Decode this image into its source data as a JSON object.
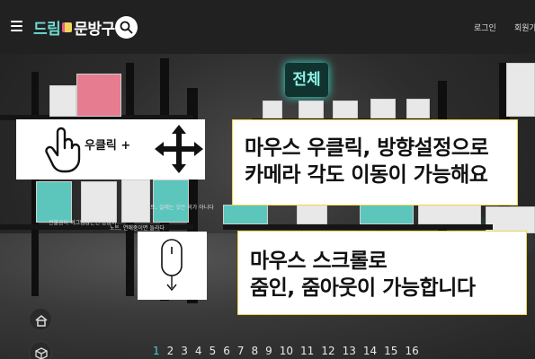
{
  "header": {
    "logo_part1": "드림",
    "logo_part2": "문방구",
    "login_label": "로그인",
    "signup_label": "회원가입"
  },
  "scene": {
    "category_title": "전체",
    "captions": [
      "썬불곰이 여그템갑은런 통꿈이",
      "노트, 실제는 것은 의가 아니다",
      "노트, 연애중이면 들라다"
    ]
  },
  "hints": {
    "right_click_label": "우클릭 +",
    "right_click_text_line1": "마우스 우클릭, 방향설정으로",
    "right_click_text_line2": "카메라 각도 이동이 가능해요",
    "scroll_text_line1": "마우스 스크롤로",
    "scroll_text_line2": "줌인, 줌아웃이 가능합니다"
  },
  "pagination": {
    "pages": [
      "1",
      "2",
      "3",
      "4",
      "5",
      "6",
      "7",
      "8",
      "9",
      "10",
      "11",
      "12",
      "13",
      "14",
      "15",
      "16"
    ],
    "current": "1"
  },
  "colors": {
    "accent": "#44d4c8",
    "hint_border": "#f0d44a",
    "header_bg": "#212121"
  }
}
